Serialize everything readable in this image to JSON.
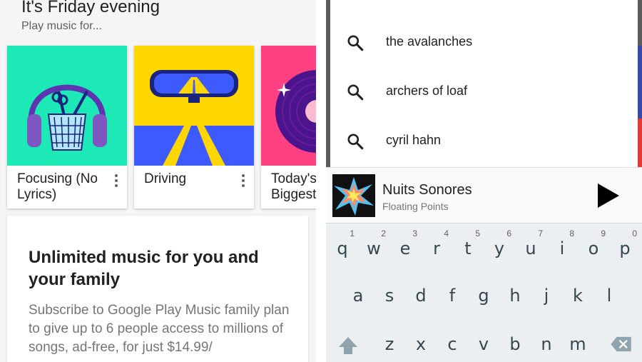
{
  "browse": {
    "heading": "It's Friday evening",
    "subheading": "Play music for...",
    "cards": [
      {
        "title": "Focusing (No Lyrics)",
        "art_color": "#1de9b6",
        "icon": "headphones-pencil-cup-art"
      },
      {
        "title": "Driving",
        "art_color": "#ffd600",
        "icon": "rearview-mirror-road-art"
      },
      {
        "title": "Today's Biggest",
        "art_color": "#ff4081",
        "icon": "vinyl-record-art"
      }
    ],
    "promo": {
      "title": "Unlimited music for you and your family",
      "body": "Subscribe to Google Play Music family plan to give up to 6 people access to millions of songs, ad-free, for just $14.99/"
    }
  },
  "search": {
    "suggestions": [
      {
        "text": "the avalanches",
        "icon": "search-icon"
      },
      {
        "text": "archers of loaf",
        "icon": "search-icon"
      },
      {
        "text": "cyril hahn",
        "icon": "search-icon"
      }
    ]
  },
  "now_playing": {
    "title": "Nuits Sonores",
    "artist": "Floating Points",
    "play_icon": "play-icon"
  },
  "keyboard": {
    "row1": [
      {
        "key": "q",
        "num": "1"
      },
      {
        "key": "w",
        "num": "2"
      },
      {
        "key": "e",
        "num": "3"
      },
      {
        "key": "r",
        "num": "4"
      },
      {
        "key": "t",
        "num": "5"
      },
      {
        "key": "y",
        "num": "6"
      },
      {
        "key": "u",
        "num": "7"
      },
      {
        "key": "i",
        "num": "8"
      },
      {
        "key": "o",
        "num": "9"
      },
      {
        "key": "p",
        "num": "0"
      }
    ],
    "row2": [
      "a",
      "s",
      "d",
      "f",
      "g",
      "h",
      "j",
      "k",
      "l"
    ],
    "row3": [
      "z",
      "x",
      "c",
      "v",
      "b",
      "n",
      "m"
    ],
    "shift_icon": "shift-arrow-icon",
    "backspace_icon": "backspace-icon"
  },
  "colors": {
    "focus_card": "#1de9b6",
    "driving_card": "#ffd600",
    "biggest_card": "#ff4081",
    "keyboard_bg": "#eceff1"
  }
}
